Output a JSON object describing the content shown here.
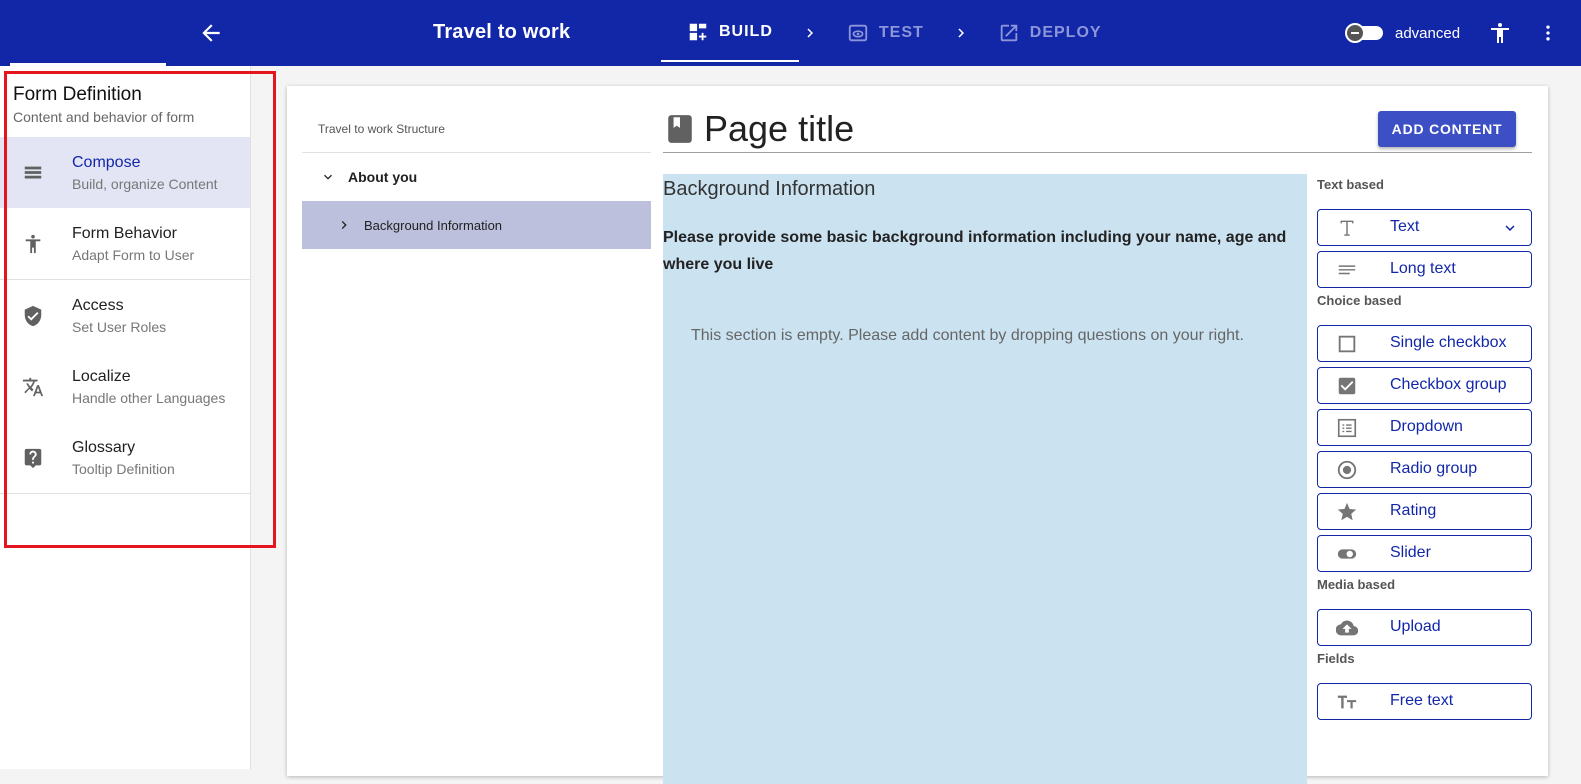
{
  "appbar": {
    "title": "Travel to work",
    "steps": [
      {
        "label": "BUILD"
      },
      {
        "label": "TEST"
      },
      {
        "label": "DEPLOY"
      }
    ],
    "advanced_label": "advanced"
  },
  "sidebar": {
    "title": "Form Definition",
    "subtitle": "Content and behavior of form",
    "items": [
      {
        "label": "Compose",
        "sub": "Build, organize Content",
        "icon": "compose-icon"
      },
      {
        "label": "Form Behavior",
        "sub": "Adapt Form to User",
        "icon": "accessibility-icon"
      },
      {
        "label": "Access",
        "sub": "Set User Roles",
        "icon": "shield-check-icon"
      },
      {
        "label": "Localize",
        "sub": "Handle other Languages",
        "icon": "translate-icon"
      },
      {
        "label": "Glossary",
        "sub": "Tooltip Definition",
        "icon": "help-bubble-icon"
      }
    ]
  },
  "tree": {
    "header": "Travel to work Structure",
    "nodes": [
      {
        "label": "About you"
      },
      {
        "label": "Background Information"
      }
    ]
  },
  "page": {
    "title": "Page title",
    "add_content_label": "ADD CONTENT"
  },
  "section": {
    "title": "Background Information",
    "description": "Please provide some basic background information including your name, age and where you live",
    "empty_message": "This section is empty. Please add content by dropping questions on your right."
  },
  "palette": {
    "groups": [
      {
        "label": "Text based",
        "items": [
          {
            "label": "Text"
          },
          {
            "label": "Long text"
          }
        ]
      },
      {
        "label": "Choice based",
        "items": [
          {
            "label": "Single checkbox"
          },
          {
            "label": "Checkbox group"
          },
          {
            "label": "Dropdown"
          },
          {
            "label": "Radio group"
          },
          {
            "label": "Rating"
          },
          {
            "label": "Slider"
          }
        ]
      },
      {
        "label": "Media based",
        "items": [
          {
            "label": "Upload"
          }
        ]
      },
      {
        "label": "Fields",
        "items": [
          {
            "label": "Free text"
          }
        ]
      }
    ]
  },
  "colors": {
    "appbar": "#1227a8",
    "accent": "#3d4fc4",
    "section_bg": "#cbe2f1",
    "highlight_border": "#e4151f"
  }
}
